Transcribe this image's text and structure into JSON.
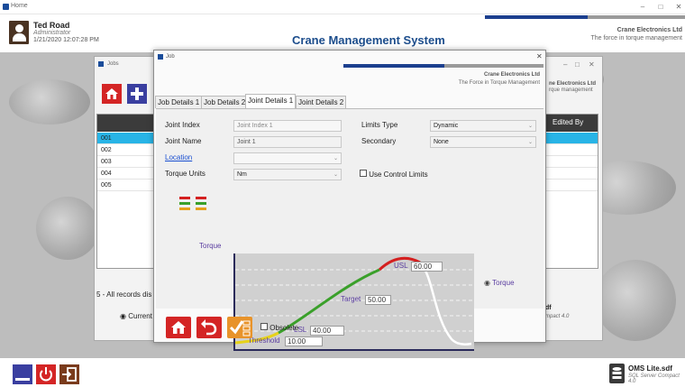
{
  "window": {
    "title": "Home"
  },
  "header": {
    "user_name": "Ted Road",
    "user_role": "Administrator",
    "user_datetime": "1/21/2020 12:07:28 PM",
    "system_title": "Crane Management System",
    "company": "Crane Electronics Ltd",
    "tagline": "The force in torque management"
  },
  "job_list": {
    "title": "Jobs",
    "column_edited_by": "Edited By",
    "rows": [
      "001",
      "002",
      "003",
      "004",
      "005"
    ],
    "selected_row": "001",
    "count_text": "5 - All records dis",
    "current_label": "Current",
    "company": "ne Electronics Ltd",
    "tagline": "rque management",
    "sdf_label": "df",
    "sdf_type": "mpact 4.0"
  },
  "dialog": {
    "title": "Job",
    "company": "Crane Electronics Ltd",
    "tagline": "The Force in Torque Management",
    "tabs": [
      "Job Details 1",
      "Job Details 2",
      "Joint Details 1",
      "Joint Details 2"
    ],
    "active_tab": "Joint Details 1",
    "fields": {
      "joint_index_label": "Joint Index",
      "joint_index_placeholder": "Joint Index 1",
      "joint_name_label": "Joint Name",
      "joint_name_value": "Joint 1",
      "location_label": "Location",
      "location_value": "",
      "torque_units_label": "Torque Units",
      "torque_units_value": "Nm",
      "limits_type_label": "Limits Type",
      "limits_type_value": "Dynamic",
      "secondary_label": "Secondary",
      "secondary_value": "None",
      "use_control_limits_label": "Use Control Limits",
      "use_control_limits_checked": false
    },
    "chart": {
      "ylabel": "Torque",
      "usl_label": "USL",
      "usl_value": "60.00",
      "target_label": "Target",
      "target_value": "50.00",
      "lsl_label": "LSL",
      "lsl_value": "40.00",
      "threshold_label": "Threshold",
      "threshold_value": "10.00",
      "legend_label": "Torque",
      "colors": {
        "usl": "#d42020",
        "target": "#3aa02a",
        "threshold": "#e6d21a",
        "release": "#ffffff"
      }
    },
    "obsolete_label": "Obsolete",
    "obsolete_checked": false
  },
  "footer": {
    "db_name": "OMS Lite.sdf",
    "db_type": "SQL Server Compact 4.0"
  }
}
